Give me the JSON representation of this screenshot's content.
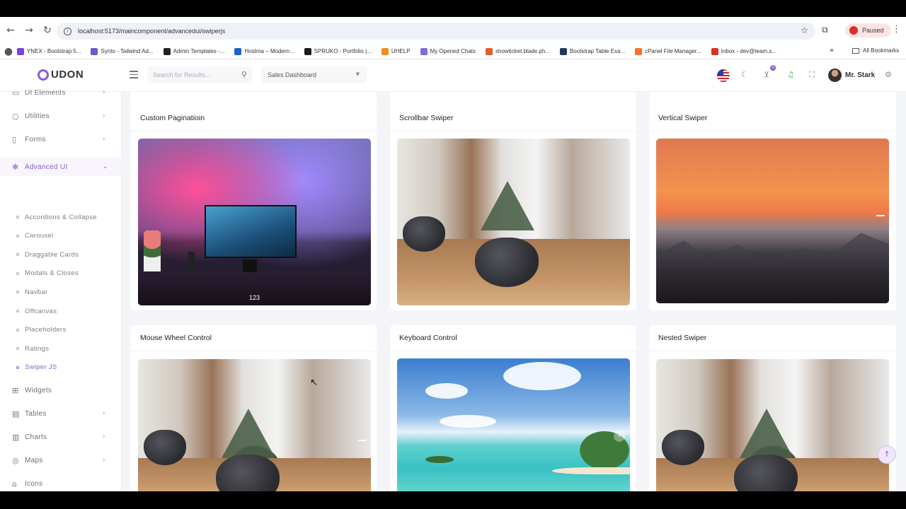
{
  "browser": {
    "url": "localhost:5173/maincomponent/advancedui/swiperjs",
    "paused_label": "Paused",
    "bookmarks": [
      {
        "label": "YNEX - Bootstrap 5...",
        "color": "#7b3fe4"
      },
      {
        "label": "Synto - Tailwind Ad...",
        "color": "#6a5acd"
      },
      {
        "label": "Admin Templates -...",
        "color": "#222222"
      },
      {
        "label": "Hostma – Modern...",
        "color": "#1e63c6"
      },
      {
        "label": "SPRUKO - Portfolio |...",
        "color": "#1a1a1a"
      },
      {
        "label": "UHELP",
        "color": "#f28c1c"
      },
      {
        "label": "My Opened Chats",
        "color": "#7a6fd8"
      },
      {
        "label": "showticket.blade.ph...",
        "color": "#e65b2c"
      },
      {
        "label": "Bootstrap Table Exa...",
        "color": "#1f3a5e"
      },
      {
        "label": "cPanel File Manager...",
        "color": "#ff6c2c"
      },
      {
        "label": "Inbox - dev@team.s...",
        "color": "#d93025"
      }
    ],
    "all_bookmarks_label": "All Bookmarks"
  },
  "header": {
    "logo_text": "UDON",
    "search_placeholder": "Search for Results...",
    "dashboard_select": "Sales Dashboard",
    "cart_count": "5",
    "user_name": "Mr. Stark"
  },
  "sidebar": {
    "items": [
      {
        "label": "UI Elements",
        "icon": "box-icon",
        "glyph": "▭",
        "has_arrow": true
      },
      {
        "label": "Utilities",
        "icon": "lightbulb-icon",
        "glyph": "○",
        "has_arrow": true
      },
      {
        "label": "Forms",
        "icon": "file-icon",
        "glyph": "▯",
        "has_arrow": true
      },
      {
        "label": "Advanced UI",
        "icon": "snowflake-icon",
        "glyph": "✻",
        "has_arrow": true,
        "expanded": true
      }
    ],
    "sub_items": [
      "Accordions & Collapse",
      "Carousel",
      "Draggable Cards",
      "Modals & Closes",
      "Navbar",
      "Offcanvas",
      "Placeholders",
      "Ratings",
      "Swiper JS"
    ],
    "active_sub": "Swiper JS",
    "bottom_items": [
      {
        "label": "Widgets",
        "icon": "gift-icon",
        "glyph": "⊞",
        "has_arrow": false
      },
      {
        "label": "Tables",
        "icon": "table-icon",
        "glyph": "▤",
        "has_arrow": true
      },
      {
        "label": "Charts",
        "icon": "chart-icon",
        "glyph": "▥",
        "has_arrow": true
      },
      {
        "label": "Maps",
        "icon": "map-pin-icon",
        "glyph": "◎",
        "has_arrow": true
      },
      {
        "label": "Icons",
        "icon": "store-icon",
        "glyph": "⌂",
        "has_arrow": false
      }
    ]
  },
  "cards": {
    "custom_pagination": {
      "title": "Custom Paginatioin",
      "page_number": "123"
    },
    "scrollbar": {
      "title": "Scrollbar Swiper"
    },
    "vertical": {
      "title": "Vertical Swiper"
    },
    "mouse_wheel": {
      "title": "Mouse Wheel Control"
    },
    "keyboard": {
      "title": "Keyboard Control"
    },
    "nested": {
      "title": "Nested Swiper"
    }
  },
  "colors": {
    "accent": "#8a5cd8",
    "danger": "#d93025"
  }
}
